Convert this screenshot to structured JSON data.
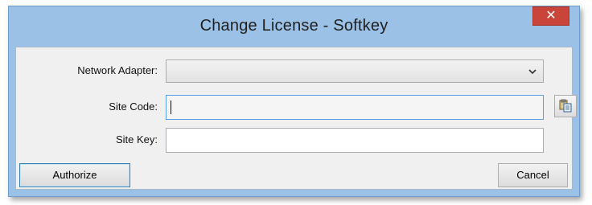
{
  "window": {
    "title": "Change License - Softkey",
    "close_glyph": "✕"
  },
  "form": {
    "network_adapter": {
      "label": "Network Adapter:",
      "value": ""
    },
    "site_code": {
      "label": "Site Code:",
      "value": ""
    },
    "site_key": {
      "label": "Site Key:",
      "value": ""
    }
  },
  "buttons": {
    "authorize_label": "Authorize",
    "cancel_label": "Cancel",
    "paste_icon": "paste-icon"
  },
  "colors": {
    "titlebar": "#9cc1e6",
    "close_button": "#c9453a",
    "client_area": "#f0f0f0",
    "focus_border": "#569de5"
  }
}
